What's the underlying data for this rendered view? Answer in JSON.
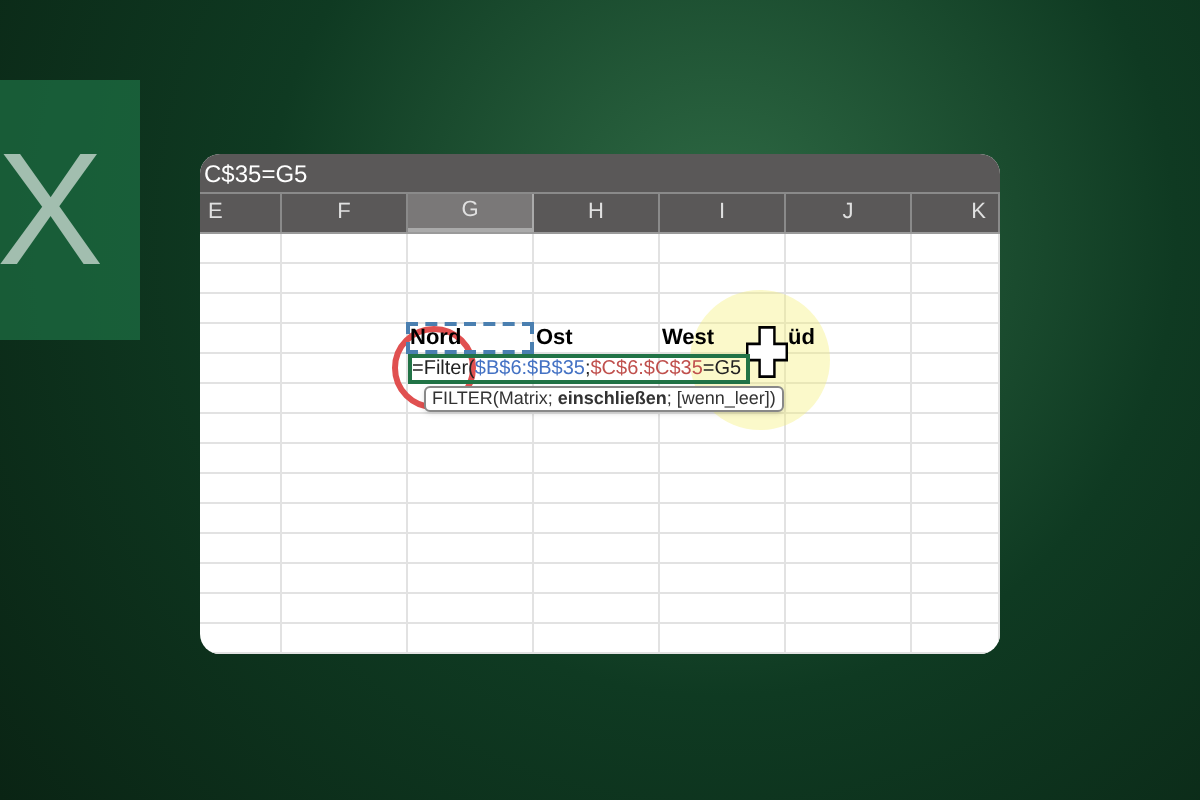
{
  "logo": {
    "letter": "X"
  },
  "formula_bar": {
    "text": "C$35=G5"
  },
  "columns": [
    {
      "label": "E",
      "selected": false
    },
    {
      "label": "F",
      "selected": false
    },
    {
      "label": "G",
      "selected": true
    },
    {
      "label": "H",
      "selected": false
    },
    {
      "label": "I",
      "selected": false
    },
    {
      "label": "J",
      "selected": false
    },
    {
      "label": "K",
      "selected": false
    }
  ],
  "header_row": {
    "cells": [
      {
        "text": "Nord",
        "selected": true
      },
      {
        "text": "Ost",
        "selected": false
      },
      {
        "text": "West",
        "selected": false
      },
      {
        "text": "üd",
        "selected": false
      }
    ]
  },
  "edit_cell": {
    "segments": [
      {
        "text": "=Filter(",
        "color": "#222222"
      },
      {
        "text": "$B$6:$B$35",
        "color": "#4472c4"
      },
      {
        "text": ";",
        "color": "#222222"
      },
      {
        "text": "$C$6:$C$35",
        "color": "#c0504d"
      },
      {
        "text": "=G5",
        "color": "#222222"
      }
    ]
  },
  "tooltip": {
    "text": "FILTER(Matrix; **einschließen**; [wenn_leer])"
  }
}
